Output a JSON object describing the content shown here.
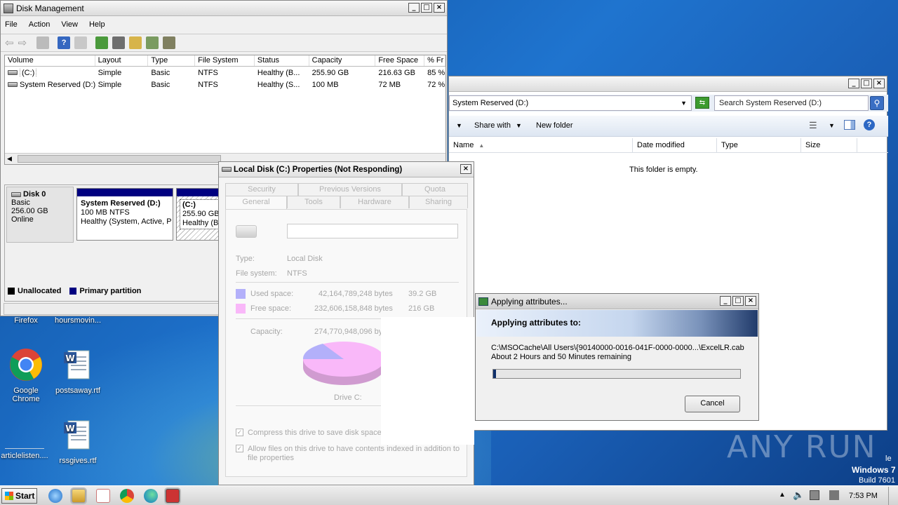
{
  "desktop": {
    "icons": [
      {
        "label": "Firefox"
      },
      {
        "label": "hoursmovin..."
      },
      {
        "label": "Google Chrome"
      },
      {
        "label": "postsaway.rtf"
      },
      {
        "label": "articlelisten...."
      },
      {
        "label": "rssgives.rtf"
      }
    ],
    "watermark": "ANY RUN",
    "os_label": "Windows 7",
    "build_label": "Build 7601",
    "partial_label": "le"
  },
  "disk_mgmt": {
    "title": "Disk Management",
    "menu": [
      "File",
      "Action",
      "View",
      "Help"
    ],
    "columns": [
      "Volume",
      "Layout",
      "Type",
      "File System",
      "Status",
      "Capacity",
      "Free Space",
      "% Fr"
    ],
    "rows": [
      [
        "(C:)",
        "Simple",
        "Basic",
        "NTFS",
        "Healthy (B...",
        "255.90 GB",
        "216.63 GB",
        "85 %"
      ],
      [
        "System Reserved (D:)",
        "Simple",
        "Basic",
        "NTFS",
        "Healthy (S...",
        "100 MB",
        "72 MB",
        "72 %"
      ]
    ],
    "disk": {
      "name": "Disk 0",
      "type": "Basic",
      "size": "256.00 GB",
      "state": "Online"
    },
    "part_d": {
      "name": "System Reserved  (D:)",
      "size": "100 MB NTFS",
      "status": "Healthy (System, Active, P"
    },
    "part_c": {
      "name": "(C:)",
      "size": "255.90 GB N",
      "status": "Healthy (Bo"
    },
    "legend": {
      "unallocated": "Unallocated",
      "primary": "Primary partition"
    },
    "colors": {
      "unallocated": "#000000",
      "primary": "#000080"
    }
  },
  "explorer": {
    "address": "System Reserved (D:)",
    "search_placeholder": "Search System Reserved (D:)",
    "share_with": "Share with",
    "new_folder": "New folder",
    "columns": [
      "Name",
      "Date modified",
      "Type",
      "Size"
    ],
    "empty_text": "This folder is empty."
  },
  "properties": {
    "title": "Local Disk (C:) Properties (Not Responding)",
    "tabs_row1": [
      "Security",
      "Previous Versions",
      "Quota"
    ],
    "tabs_row2": [
      "General",
      "Tools",
      "Hardware",
      "Sharing"
    ],
    "type_label": "Type:",
    "type_value": "Local Disk",
    "fs_label": "File system:",
    "fs_value": "NTFS",
    "used_label": "Used space:",
    "used_bytes": "42,164,789,248 bytes",
    "used_gb": "39.2 GB",
    "free_label": "Free space:",
    "free_bytes": "232,606,158,848 bytes",
    "free_gb": "216 GB",
    "cap_label": "Capacity:",
    "cap_bytes": "274,770,948,096 byt",
    "drive_label": "Drive C:",
    "compress": "Compress this drive to save disk space",
    "index": "Allow files on this drive to have contents indexed in addition to file properties",
    "colors": {
      "used": "#9a96f8",
      "free": "#f7a0f7"
    }
  },
  "progress": {
    "title": "Applying attributes...",
    "heading": "Applying attributes to:",
    "path": "C:\\MSOCache\\All Users\\{90140000-0016-041F-0000-0000...\\ExcelLR.cab",
    "remaining": "About 2 Hours and 50 Minutes remaining",
    "percent": 1,
    "cancel": "Cancel"
  },
  "taskbar": {
    "start": "Start",
    "time": "7:53 PM"
  }
}
